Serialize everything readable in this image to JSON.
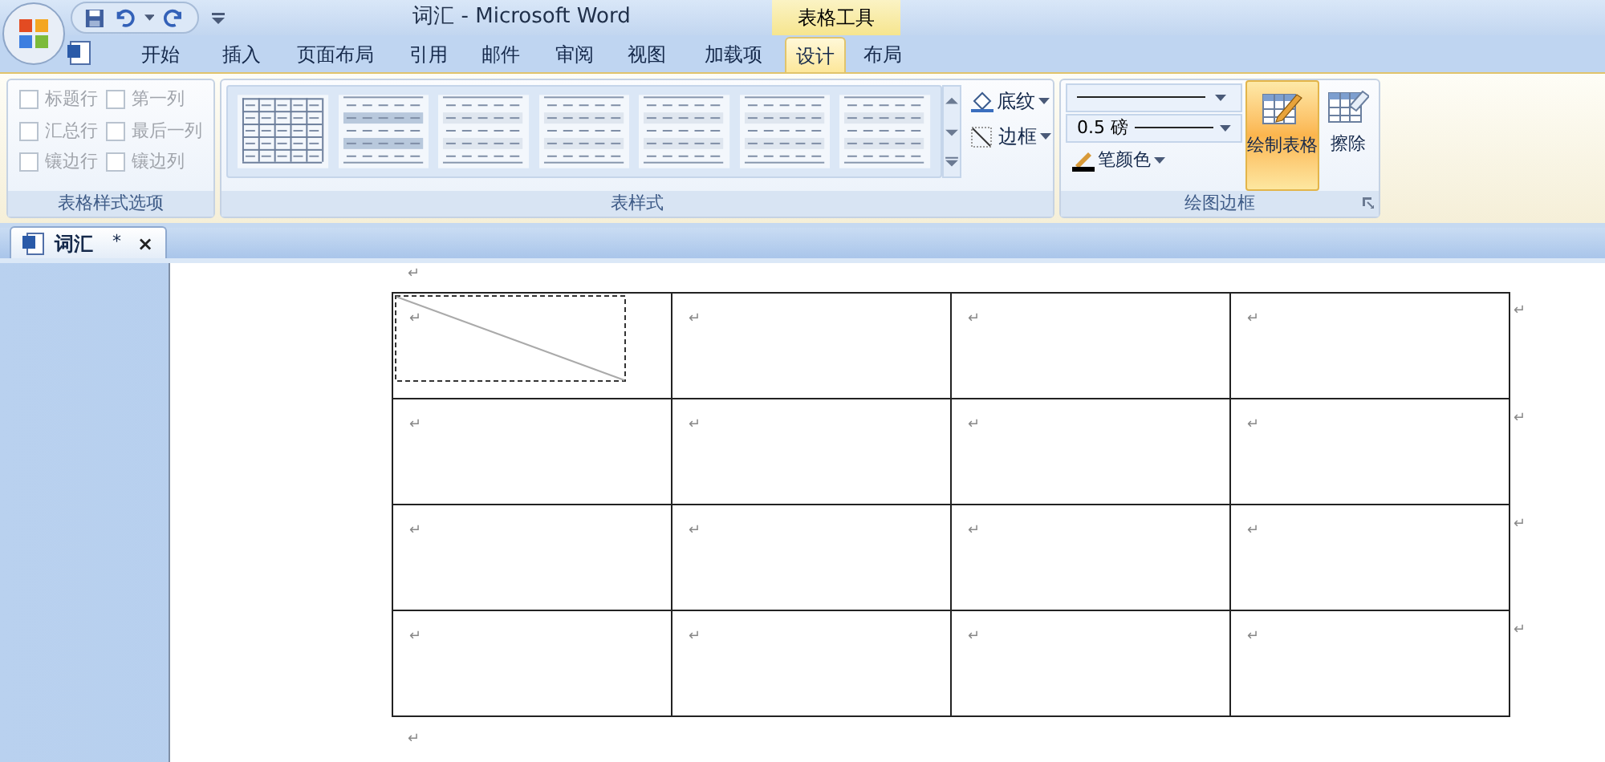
{
  "title_bar": {
    "title": "词汇 - Microsoft Word",
    "context_label": "表格工具"
  },
  "ribbon_tabs": [
    {
      "label": "开始",
      "selected": false
    },
    {
      "label": "插入",
      "selected": false
    },
    {
      "label": "页面布局",
      "selected": false
    },
    {
      "label": "引用",
      "selected": false
    },
    {
      "label": "邮件",
      "selected": false
    },
    {
      "label": "审阅",
      "selected": false
    },
    {
      "label": "视图",
      "selected": false
    },
    {
      "label": "加载项",
      "selected": false
    },
    {
      "label": "设计",
      "selected": true
    },
    {
      "label": "布局",
      "selected": false
    }
  ],
  "style_options": {
    "title": "表格样式选项",
    "checkboxes": [
      {
        "label": "标题行",
        "checked": false
      },
      {
        "label": "第一列",
        "checked": false
      },
      {
        "label": "汇总行",
        "checked": false
      },
      {
        "label": "最后一列",
        "checked": false
      },
      {
        "label": "镶边行",
        "checked": false
      },
      {
        "label": "镶边列",
        "checked": false
      }
    ]
  },
  "table_styles": {
    "title": "表样式",
    "shading": "底纹",
    "borders": "边框"
  },
  "draw_borders": {
    "title": "绘图边框",
    "line_weight": "0.5 磅",
    "pen_color": "笔颜色",
    "draw_table": {
      "label": "绘制表格",
      "selected": true
    },
    "eraser": "擦除"
  },
  "doc_tab": {
    "name": "词汇",
    "modified": "*",
    "close": "×"
  },
  "document": {
    "mark_before": "↵",
    "mark_after": "↵",
    "rows": [
      {
        "cells": [
          "↵",
          "↵",
          "↵",
          "↵"
        ],
        "end": "↵"
      },
      {
        "cells": [
          "↵",
          "↵",
          "↵",
          "↵"
        ],
        "end": "↵"
      },
      {
        "cells": [
          "↵",
          "↵",
          "↵",
          "↵"
        ],
        "end": "↵"
      },
      {
        "cells": [
          "↵",
          "↵",
          "↵",
          "↵"
        ],
        "end": "↵"
      }
    ]
  }
}
